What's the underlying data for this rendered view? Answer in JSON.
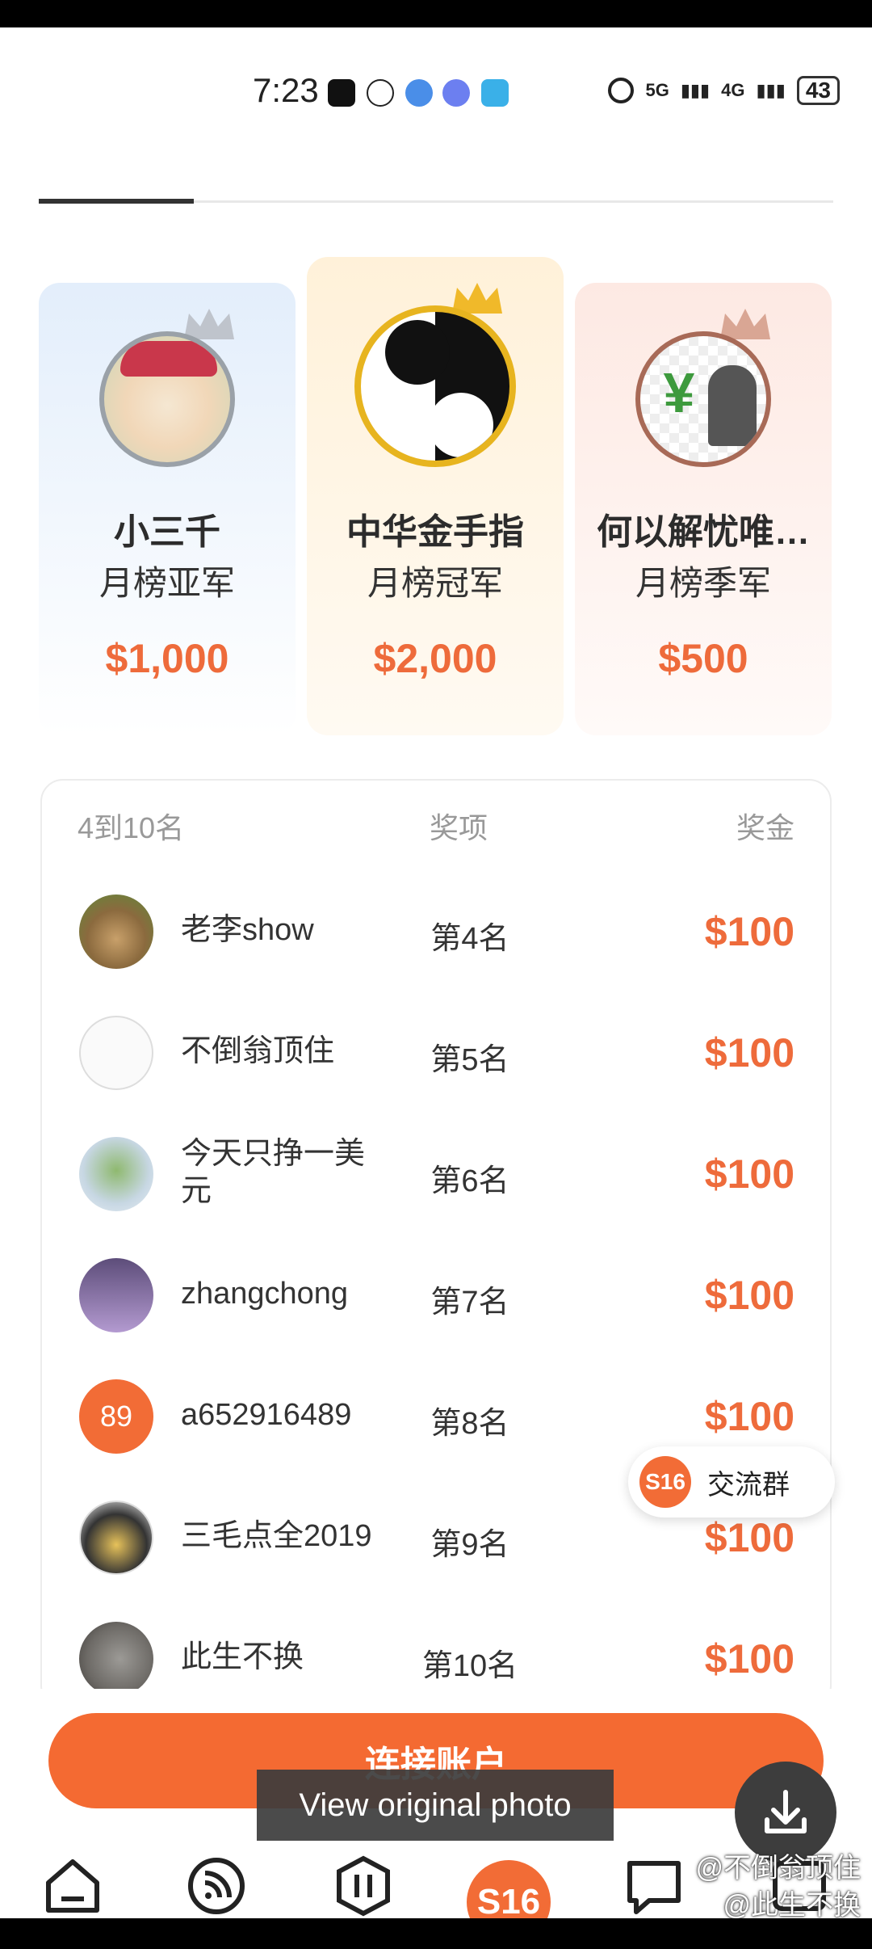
{
  "status_bar": {
    "time": "7:23",
    "net1": "5G",
    "net2": "4G",
    "battery": "43"
  },
  "top3": [
    {
      "name": "小三千",
      "rank": "月榜亚军",
      "prize": "$1,000"
    },
    {
      "name": "中华金手指",
      "rank": "月榜冠军",
      "prize": "$2,000"
    },
    {
      "name": "何以解忧唯…",
      "rank": "月榜季军",
      "prize": "$500"
    }
  ],
  "list_header": {
    "col1": "4到10名",
    "col2": "奖项",
    "col3": "奖金"
  },
  "rows": [
    {
      "name": "老李show",
      "rank": "第4名",
      "prize": "$100"
    },
    {
      "name": "不倒翁顶住",
      "rank": "第5名",
      "prize": "$100"
    },
    {
      "name": "今天只挣一美元",
      "rank": "第6名",
      "prize": "$100"
    },
    {
      "name": "zhangchong",
      "rank": "第7名",
      "prize": "$100"
    },
    {
      "name": "a652916489",
      "rank": "第8名",
      "prize": "$100",
      "avatar_text": "89"
    },
    {
      "name": "三毛点全2019",
      "rank": "第9名",
      "prize": "$100"
    },
    {
      "name": "此生不换",
      "rank": "第10名",
      "prize": "$100"
    }
  ],
  "group_button": {
    "logo": "S16",
    "label": "交流群"
  },
  "connect_button": "连接账户",
  "toast": "View original photo",
  "nav_center": "S16",
  "watermark": {
    "line1": "@不倒翁顶住",
    "line2": "@此生不换"
  }
}
